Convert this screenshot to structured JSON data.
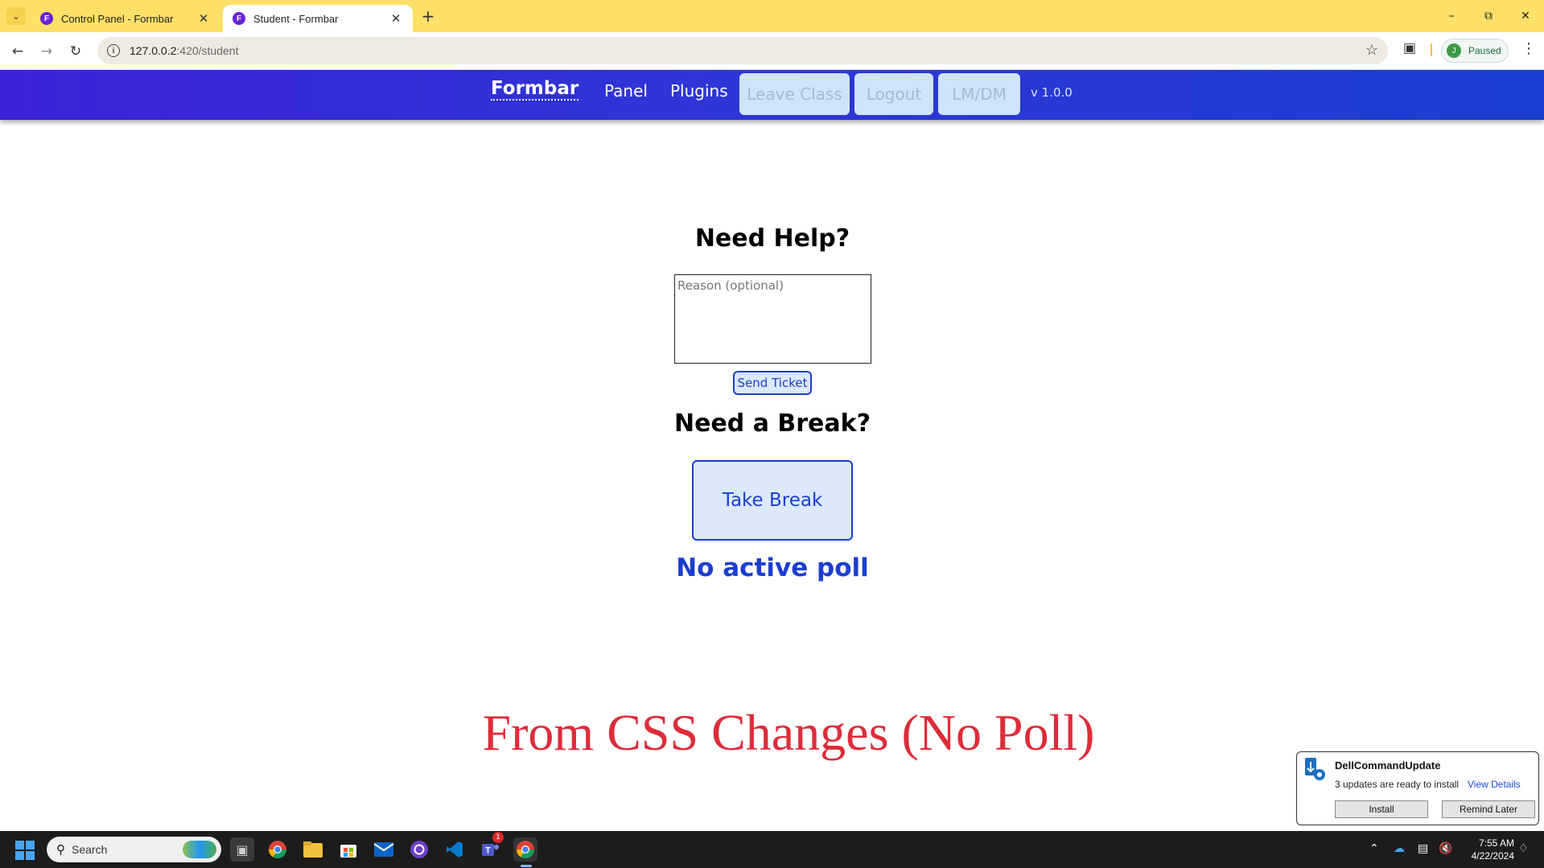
{
  "browser": {
    "tabs": [
      {
        "title": "Control Panel - Formbar",
        "favicon": "F"
      },
      {
        "title": "Student - Formbar",
        "favicon": "F"
      }
    ],
    "url_host": "127.0.0.2",
    "url_path": ":420/student",
    "profile": {
      "initial": "J",
      "status": "Paused"
    }
  },
  "appnav": {
    "brand": "Formbar",
    "links": [
      "Panel",
      "Plugins"
    ],
    "buttons": [
      "Leave Class",
      "Logout",
      "LM/DM"
    ],
    "version": "v 1.0.0"
  },
  "main": {
    "help_heading": "Need Help?",
    "reason_placeholder": "Reason (optional)",
    "send_label": "Send Ticket",
    "break_heading": "Need a Break?",
    "break_label": "Take Break",
    "poll_status": "No active poll",
    "caption": "From CSS Changes (No Poll)"
  },
  "toast": {
    "title": "DellCommandUpdate",
    "message": "3 updates are ready to install",
    "link": "View Details",
    "install_label": "Install",
    "remind_label": "Remind Later"
  },
  "taskbar": {
    "search_placeholder": "Search",
    "teams_badge": "1",
    "time": "7:55 AM",
    "date": "4/22/2024"
  },
  "colors": {
    "accent": "#1b3ed0",
    "tabbar": "#fde068",
    "caption": "#dd2c3a"
  }
}
